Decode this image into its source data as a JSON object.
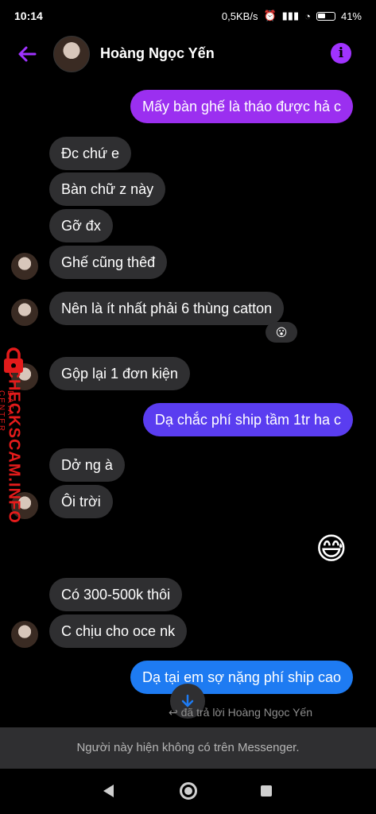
{
  "status_bar": {
    "time": "10:14",
    "speed": "0,5KB/s",
    "battery": "41%"
  },
  "header": {
    "contact_name": "Hoàng Ngọc Yến",
    "back_icon": "arrow-left-icon",
    "info_icon": "info-icon",
    "accent": "#a033ff"
  },
  "messages": [
    {
      "text": "Mấy bàn ghế là tháo được hả c",
      "dir": "out"
    },
    {
      "text": "Đc chứ e",
      "dir": "in"
    },
    {
      "text": "Bàn chữ z này",
      "dir": "in"
    },
    {
      "text": "Gỡ đx",
      "dir": "in"
    },
    {
      "text": "Ghế cũng thêđ",
      "dir": "in"
    },
    {
      "text": "Nên là ít nhất phải 6 thùng catton",
      "dir": "in"
    },
    {
      "text": "Gộp lại 1 đơn kiện",
      "dir": "in"
    },
    {
      "text": "Dạ chắc phí ship tầm 1tr ha c",
      "dir": "out"
    },
    {
      "text": "Dở ng à",
      "dir": "in"
    },
    {
      "text": "Ôi trời",
      "dir": "in"
    },
    {
      "text": "😅",
      "dir": "out"
    },
    {
      "text": "Có 300-500k thôi",
      "dir": "in"
    },
    {
      "text": "C chịu cho oce nk",
      "dir": "in"
    },
    {
      "text": "Dạ tại em sợ nặng phí ship cao",
      "dir": "out"
    }
  ],
  "reaction": "😮",
  "watermark": {
    "text": "CHECKSCAM.INFO",
    "sub": "DATA CENTER"
  },
  "reply_note": "đã trả lời Hoàng Ngọc Yến",
  "notice": "Người này hiện không có trên Messenger."
}
